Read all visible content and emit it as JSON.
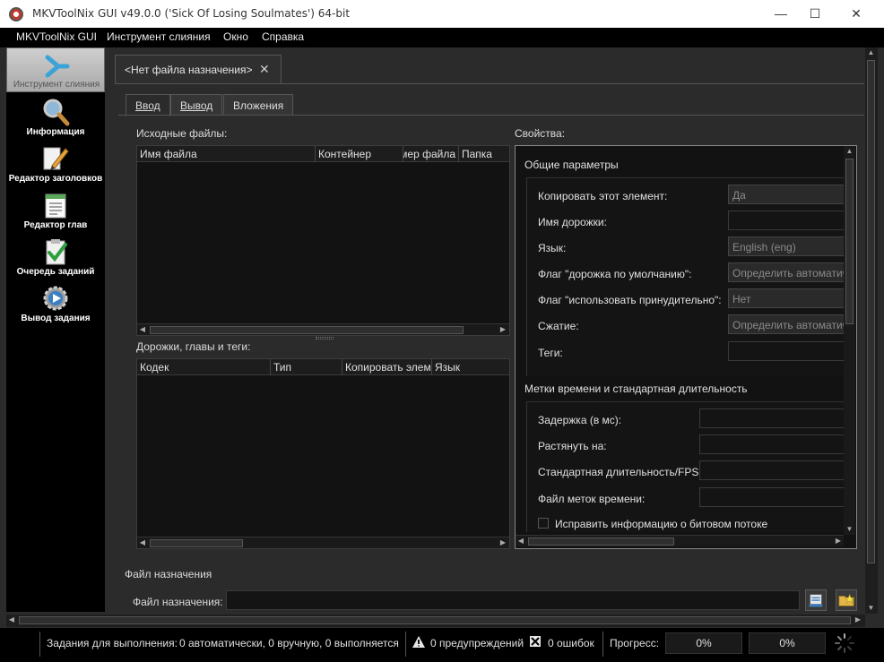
{
  "window": {
    "title": "MKVToolNix GUI v49.0.0 ('Sick Of Losing Soulmates') 64-bit",
    "minimize": "—",
    "maximize": "☐",
    "close": "✕"
  },
  "menu": [
    "MKVToolNix GUI",
    "Инструмент слияния",
    "Окно",
    "Справка"
  ],
  "sidebar": {
    "items": [
      {
        "label": "Инструмент слияния",
        "icon": "merge-arrow-icon",
        "active": true
      },
      {
        "label": "Информация",
        "icon": "magnifier-icon"
      },
      {
        "label": "Редактор заголовков",
        "icon": "pencil-icon"
      },
      {
        "label": "Редактор глав",
        "icon": "notepad-icon"
      },
      {
        "label": "Очередь заданий",
        "icon": "checklist-icon"
      },
      {
        "label": "Вывод задания",
        "icon": "gear-play-icon"
      }
    ]
  },
  "doc_tab": {
    "title": "<Нет файла назначения>",
    "close_icon": "pin-close-icon"
  },
  "subtabs": [
    "Ввод",
    "Вывод",
    "Вложения"
  ],
  "source_files": {
    "label": "Исходные файлы:",
    "columns": [
      "Имя файла",
      "Контейнер",
      "мер файла",
      "Папка"
    ]
  },
  "tracks": {
    "label": "Дорожки, главы и теги:",
    "columns": [
      "Кодек",
      "Тип",
      "Копировать элем",
      "Язык"
    ]
  },
  "properties": {
    "label": "Свойства:",
    "general": {
      "title": "Общие параметры",
      "copy_item": {
        "label": "Копировать этот элемент:",
        "value": "Да"
      },
      "track_name": {
        "label": "Имя дорожки:"
      },
      "language": {
        "label": "Язык:",
        "value": "English (eng)"
      },
      "default_flag": {
        "label": "Флаг \"дорожка по умолчанию\":",
        "value": "Определить автоматически"
      },
      "forced_flag": {
        "label": "Флаг \"использовать принудительно\":",
        "value": "Нет"
      },
      "compression": {
        "label": "Сжатие:",
        "value": "Определить автоматически"
      },
      "tags": {
        "label": "Теги:"
      }
    },
    "timing": {
      "title": "Метки времени и стандартная длительность",
      "delay": {
        "label": "Задержка (в мс):"
      },
      "stretch": {
        "label": "Растянуть на:"
      },
      "default_duration": {
        "label": "Стандартная длительность/FPS:"
      },
      "timestamps_file": {
        "label": "Файл меток времени:"
      },
      "fix_bitstream": {
        "label": "Исправить информацию о битовом потоке",
        "checked": false
      }
    }
  },
  "destination": {
    "section": "Файл назначения",
    "label": "Файл назначения:",
    "value": ""
  },
  "status": {
    "jobs_label": "Задания для выполнения:",
    "jobs_value": "0 автоматически, 0 вручную, 0 выполняется",
    "warnings": "0 предупреждений",
    "errors": "0 ошибок",
    "progress_label": "Прогресс:",
    "progress_current": "0%",
    "progress_total": "0%"
  }
}
